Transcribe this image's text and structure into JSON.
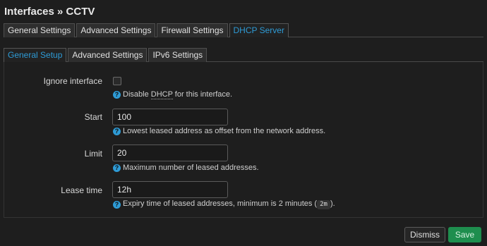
{
  "page": {
    "title": "Interfaces » CCTV"
  },
  "main_tabs": [
    {
      "label": "General Settings",
      "active": false
    },
    {
      "label": "Advanced Settings",
      "active": false
    },
    {
      "label": "Firewall Settings",
      "active": false
    },
    {
      "label": "DHCP Server",
      "active": true
    }
  ],
  "sub_tabs": [
    {
      "label": "General Setup",
      "active": true
    },
    {
      "label": "Advanced Settings",
      "active": false
    },
    {
      "label": "IPv6 Settings",
      "active": false
    }
  ],
  "fields": {
    "ignore_interface": {
      "label": "Ignore interface",
      "checked": false,
      "hint_prefix": "Disable ",
      "hint_abbr": "DHCP",
      "hint_suffix": " for this interface."
    },
    "start": {
      "label": "Start",
      "value": "100",
      "hint": "Lowest leased address as offset from the network address."
    },
    "limit": {
      "label": "Limit",
      "value": "20",
      "hint": "Maximum number of leased addresses."
    },
    "lease_time": {
      "label": "Lease time",
      "value": "12h",
      "hint_prefix": "Expiry time of leased addresses, minimum is 2 minutes (",
      "hint_code": "2m",
      "hint_suffix": ")."
    }
  },
  "help_icon_glyph": "?",
  "buttons": {
    "dismiss": "Dismiss",
    "save": "Save"
  },
  "colors": {
    "accent": "#2e9bd6",
    "save": "#1e8e4e",
    "background": "#1e1e1e"
  }
}
